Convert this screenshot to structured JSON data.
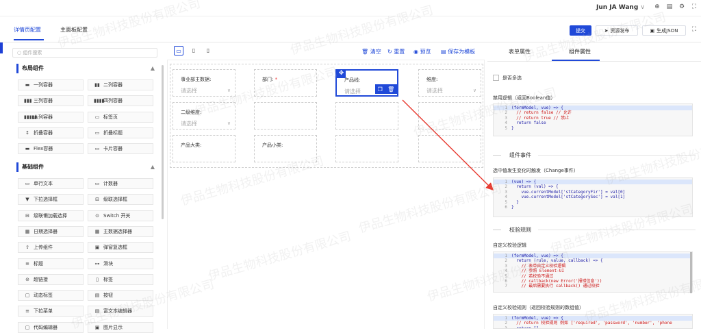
{
  "header": {
    "user": "Jun JA Wang",
    "user_chevron": "∨"
  },
  "page_tabs": [
    "详情页配置",
    "主面板配置"
  ],
  "actions": {
    "submit": "提交",
    "publish": "资源发布",
    "json": "生成JSON"
  },
  "left": {
    "search_placeholder": "组件搜索",
    "groups": [
      {
        "title": "布局组件",
        "items": [
          "一列容器",
          "二列容器",
          "三列容器",
          "四列容器",
          "六列容器",
          "标签页",
          "折叠容器",
          "折叠标题",
          "Flex容器",
          "卡片容器"
        ]
      },
      {
        "title": "基础组件",
        "items": [
          "单行文本",
          "计数器",
          "下拉选择框",
          "级联选择框",
          "级联懒加载选择",
          "Switch 开关",
          "日期选择器",
          "主数据选择器",
          "上传组件",
          "弹窗复选框",
          "标题",
          "滑块",
          "超链接",
          "标签",
          "动态标签",
          "按钮",
          "下拉菜单",
          "富文本编辑器",
          "代码编辑器",
          "图片显示"
        ]
      }
    ]
  },
  "toolbar": {
    "clear": "清空",
    "reset": "重置",
    "preview": "预览",
    "save_template": "保存为模板"
  },
  "form": {
    "rows": [
      [
        {
          "label": "事业部主数据:",
          "placeholder": "请选择",
          "req": false
        },
        {
          "label": "部门:",
          "placeholder": "",
          "req": true
        },
        {
          "label": "产品线:",
          "placeholder": "请选择",
          "req": false
        },
        {
          "label": "维度:",
          "placeholder": "请选择",
          "req": false
        }
      ],
      [
        {
          "label": "二级维度:",
          "placeholder": "请选择",
          "req": false
        },
        {
          "label": "",
          "placeholder": "",
          "req": false
        },
        {
          "label": "",
          "placeholder": "",
          "req": false
        },
        {
          "label": "",
          "placeholder": "",
          "req": false
        }
      ],
      [
        {
          "label": "产品大类:",
          "placeholder": "",
          "req": false
        },
        {
          "label": "产品小类:",
          "placeholder": "",
          "req": false
        },
        {
          "label": "",
          "placeholder": "",
          "req": false
        },
        {
          "label": "",
          "placeholder": "",
          "req": false
        }
      ]
    ]
  },
  "right": {
    "tabs": [
      "表单属性",
      "组件属性"
    ],
    "multi_label": "是否多选",
    "disable_label": "禁用逻辑（返回Boolean值）",
    "disable_code": [
      "(formModel, vue) => {",
      "  // return false // 允许",
      "  // return true // 禁止",
      "  return false",
      "}"
    ],
    "events_title": "组件事件",
    "change_label": "选中值发生变化时触发（Change事件）",
    "change_code": [
      "(vue) => {",
      "  return (val) => {",
      "    vue.currentModel['stCategoryFir'] = val[0]",
      "    vue.currentModel['stCategorySec'] = val[1]",
      "  }",
      "}"
    ],
    "validate_title": "校验规则",
    "custom_label": "自定义校验逻辑",
    "custom_code": [
      "(formModel, vue) => {",
      "  return (rule, value, callback) => {",
      "    // 表单自定义校验逻辑",
      "    // 参照 Element-UI",
      "    // 若校验不通过",
      "    // callback(new Error('报错信息'))",
      "    // 最后需要执行 callback() 通过校验"
    ],
    "rules_label": "自定义校验规则（返回校验规则的数组值）",
    "rules_code": [
      "(formModel, vue) => {",
      "  // return 校验规则 例如 ['required', 'password', 'number', 'phone",
      "  return []"
    ]
  },
  "watermark": "伊品生物科技股份有限公司"
}
